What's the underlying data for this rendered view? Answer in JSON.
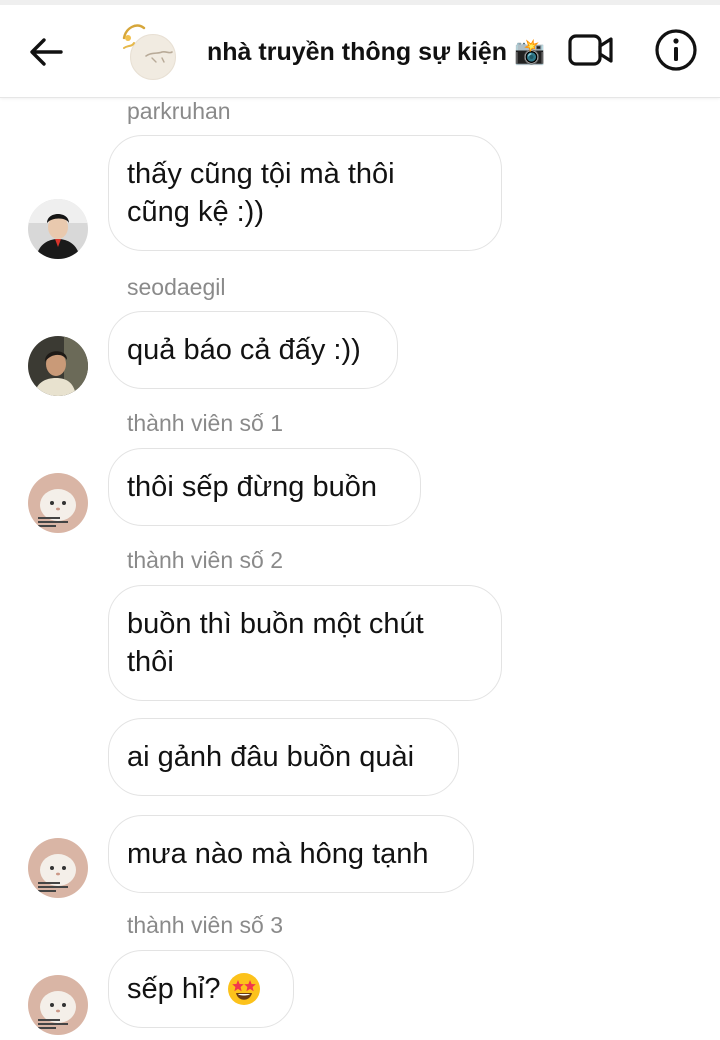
{
  "header": {
    "title": "nhà truyền thông sự kiện 📸",
    "back_icon": "arrow-left-icon",
    "video_icon": "video-call-icon",
    "info_icon": "info-icon"
  },
  "messages": [
    {
      "sender": "parkruhan",
      "text": "thấy cũng tội mà thôi\ncũng kệ :))",
      "avatar": "male-portrait-avatar"
    },
    {
      "sender": "seodaegil",
      "text": "quả báo cả đấy :))",
      "avatar": "male-portrait-avatar"
    },
    {
      "sender": "thành viên số 1",
      "text": "thôi sếp đừng buồn",
      "avatar": "cat-photo-avatar"
    },
    {
      "sender": "thành viên số 2",
      "texts": [
        "buồn thì buồn một chút\nthôi",
        "ai gảnh đâu buồn quài",
        "mưa nào mà hông tạnh"
      ],
      "avatar": "cat-photo-avatar"
    },
    {
      "sender": "thành viên số 3",
      "text": "sếp hỉ?",
      "emoji": "star-struck-emoji",
      "avatar": "cat-photo-avatar"
    }
  ],
  "colors": {
    "bubble_border": "#e3e3e3",
    "sender_text": "#8a8a8a",
    "emoji_yellow": "#fcc21b",
    "emoji_star_red": "#f2374c"
  }
}
